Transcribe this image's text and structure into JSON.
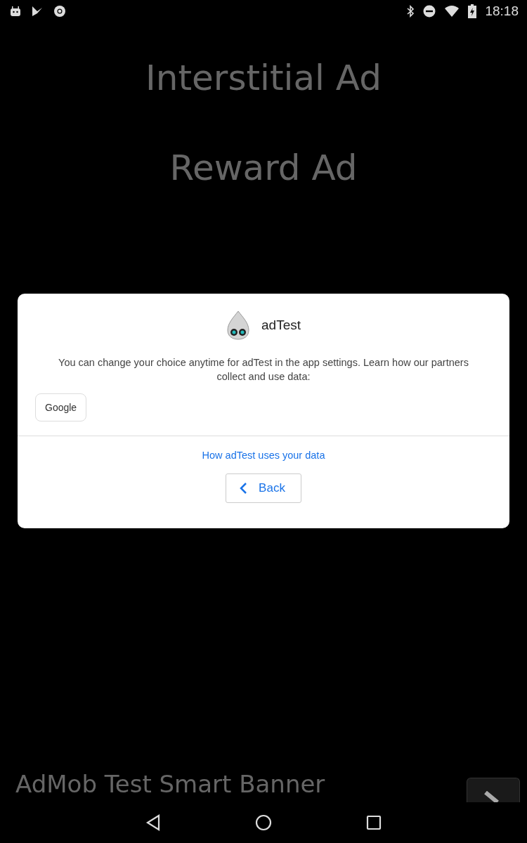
{
  "status_bar": {
    "time": "18:18"
  },
  "menu": [
    {
      "label": "Interstitial Ad"
    },
    {
      "label": "Reward Ad"
    }
  ],
  "dialog": {
    "app_name": "adTest",
    "message": "You can change your choice anytime for adTest in the app settings. Learn how our partners collect and use data:",
    "partners": [
      "Google"
    ],
    "link": "How adTest uses your data",
    "back_button": "Back"
  },
  "banner": {
    "text": "AdMob Test Smart Banner"
  }
}
